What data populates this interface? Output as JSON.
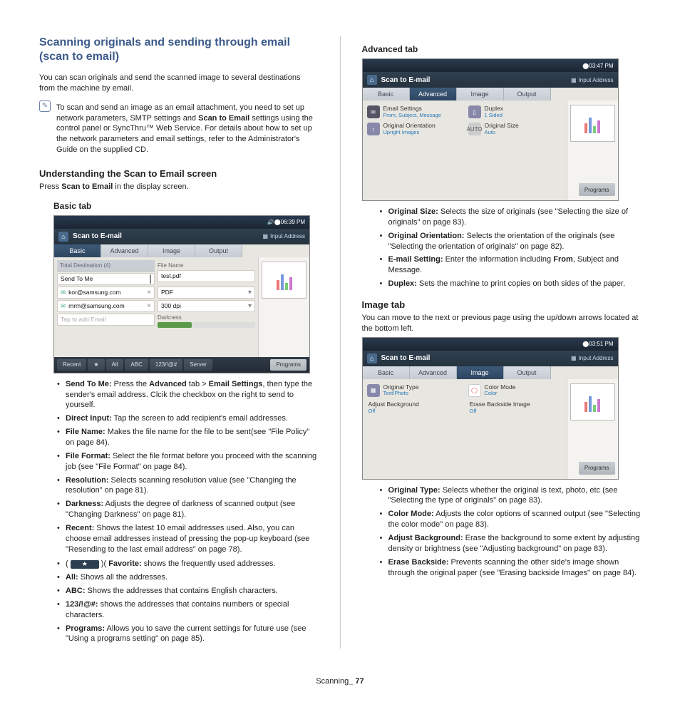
{
  "title": "Scanning originals and sending through email (scan to email)",
  "intro": "You can scan originals and send the scanned image to several destinations from the machine by email.",
  "note": {
    "p1": "To scan and send an image as an email attachment, you need to set up network parameters, SMTP settings and ",
    "b1": "Scan to Email",
    "p2": " settings using the control panel or SyncThru™ Web Service. For details about how to set up the network parameters and email settings, refer to the Administrator's Guide on the supplied CD."
  },
  "understand_h": "Understanding the Scan to Email screen",
  "press_pre": "Press ",
  "press_b": "Scan to Email",
  "press_post": " in the display screen.",
  "basic_h": "Basic tab",
  "advanced_h": "Advanced tab",
  "image_h": "Image tab",
  "image_intro": "You can move to the next or previous page using the up/down arrows located at the bottom left.",
  "footer_pre": "Scanning",
  "footer_b": "_ 77",
  "shot": {
    "app_title": "Scan to E-mail",
    "input_addr": "Input Address",
    "tabs": {
      "basic": "Basic",
      "advanced": "Advanced",
      "image": "Image",
      "output": "Output"
    },
    "programs": "Programs",
    "basic": {
      "time": "06:39 PM",
      "dest": "Total Destination (4)",
      "sendme": "Send To Me",
      "email1": "kor@samsung.com",
      "email2": "mrm@samsung.com",
      "tap": "Tap to add Email",
      "file_name_l": "File Name",
      "file_name_v": "test.pdf",
      "fmt": "PDF",
      "res": "300 dpi",
      "dark": "Darkness",
      "btns": {
        "recent": "Recent",
        "all": "All",
        "abc": "ABC",
        "num": "123/!@#",
        "server": "Server"
      }
    },
    "adv": {
      "time": "03:47 PM",
      "email_settings": "Email Settings",
      "email_settings_v": "From, Subject, Message",
      "duplex": "Duplex",
      "duplex_v": "1 Sided",
      "orient": "Original Orientation",
      "orient_v": "Upright Images",
      "size": "Original Size",
      "size_v": "Auto"
    },
    "img": {
      "time": "03:51 PM",
      "otype": "Original Type",
      "otype_v": "Text/Photo",
      "color": "Color Mode",
      "color_v": "Color",
      "bg": "Adjust Background",
      "bg_v": "Off",
      "erase": "Erase Backside Image",
      "erase_v": "Off"
    }
  },
  "basic_list": [
    {
      "b": "Send To Me:",
      "t": "  Press the ",
      "b2": "Advanced",
      "t2": " tab > ",
      "b3": "Email Settings",
      "t3": ", then type the sender's email address. Clcik the checkbox on the right to send to yourself."
    },
    {
      "b": "Direct Input:",
      "t": "  Tap the screen to add recipient's email addresses."
    },
    {
      "b": "File Name:",
      "t": "  Makes the file name for the file to be sent(see \"File Policy\" on page 84)."
    },
    {
      "b": "File Format:",
      "t": "  Select the file format before you proceed with the scanning job (see \"File Format\" on page 84)."
    },
    {
      "b": "Resolution:",
      "t": "  Selects scanning resolution value (see \"Changing the resolution\" on page 81)."
    },
    {
      "b": "Darkness:",
      "t": "  Adjusts the degree of darkness of scanned output (see \"Changing Darkness\" on page 81)."
    },
    {
      "b": "Recent:",
      "t": "  Shows the latest 10 email addresses used. Also, you can choose email addresses instead of pressing the pop-up keyboard (see \"Resending to the last email address\" on page 78)."
    }
  ],
  "basic_list2": [
    {
      "pre": "( ",
      "b": "Favorite:",
      "t": "  shows the frequently used addresses.",
      "fav": true
    },
    {
      "b": "All:",
      "t": "  Shows all the addresses."
    },
    {
      "b": "ABC:",
      "t": "  Shows the addresses that contains English characters."
    },
    {
      "b": "123/!@#:",
      "t": "  shows the addresses that contains numbers or special characters."
    },
    {
      "b": "Programs:",
      "t": "  Allows you to save the current settings for future use (see \"Using a programs setting\" on page 85)."
    }
  ],
  "adv_list": [
    {
      "b": "Original Size:",
      "t": "  Selects the size of originals (see \"Selecting the size of originals\" on page 83)."
    },
    {
      "b": "Original Orientation:",
      "t": "  Selects the orientation of the originals (see \"Selecting the orientation of originals\" on page 82)."
    },
    {
      "b": "E-mail Setting:",
      "t": "  Enter the information including ",
      "b2": "From",
      "t2": ", Subject and Message."
    },
    {
      "b": "Duplex:",
      "t": "  Sets the machine to print copies on both sides of the paper."
    }
  ],
  "img_list": [
    {
      "b": "Original Type:",
      "t": "  Selects whether the original is text, photo, etc (see \"Selecting the type of originals\" on page 83)."
    },
    {
      "b": "Color Mode:",
      "t": "  Adjusts the color options of scanned output (see \"Selecting the color mode\" on page 83)."
    },
    {
      "b": "Adjust Background:",
      "t": "  Erase the background to some extent by adjusting density or brightness (see \"Adjusting background\" on page 83)."
    },
    {
      "b": "Erase Backside:",
      "t": "  Prevents scanning the other side's image shown through the original paper (see \"Erasing backside Images\" on page 84)."
    }
  ]
}
